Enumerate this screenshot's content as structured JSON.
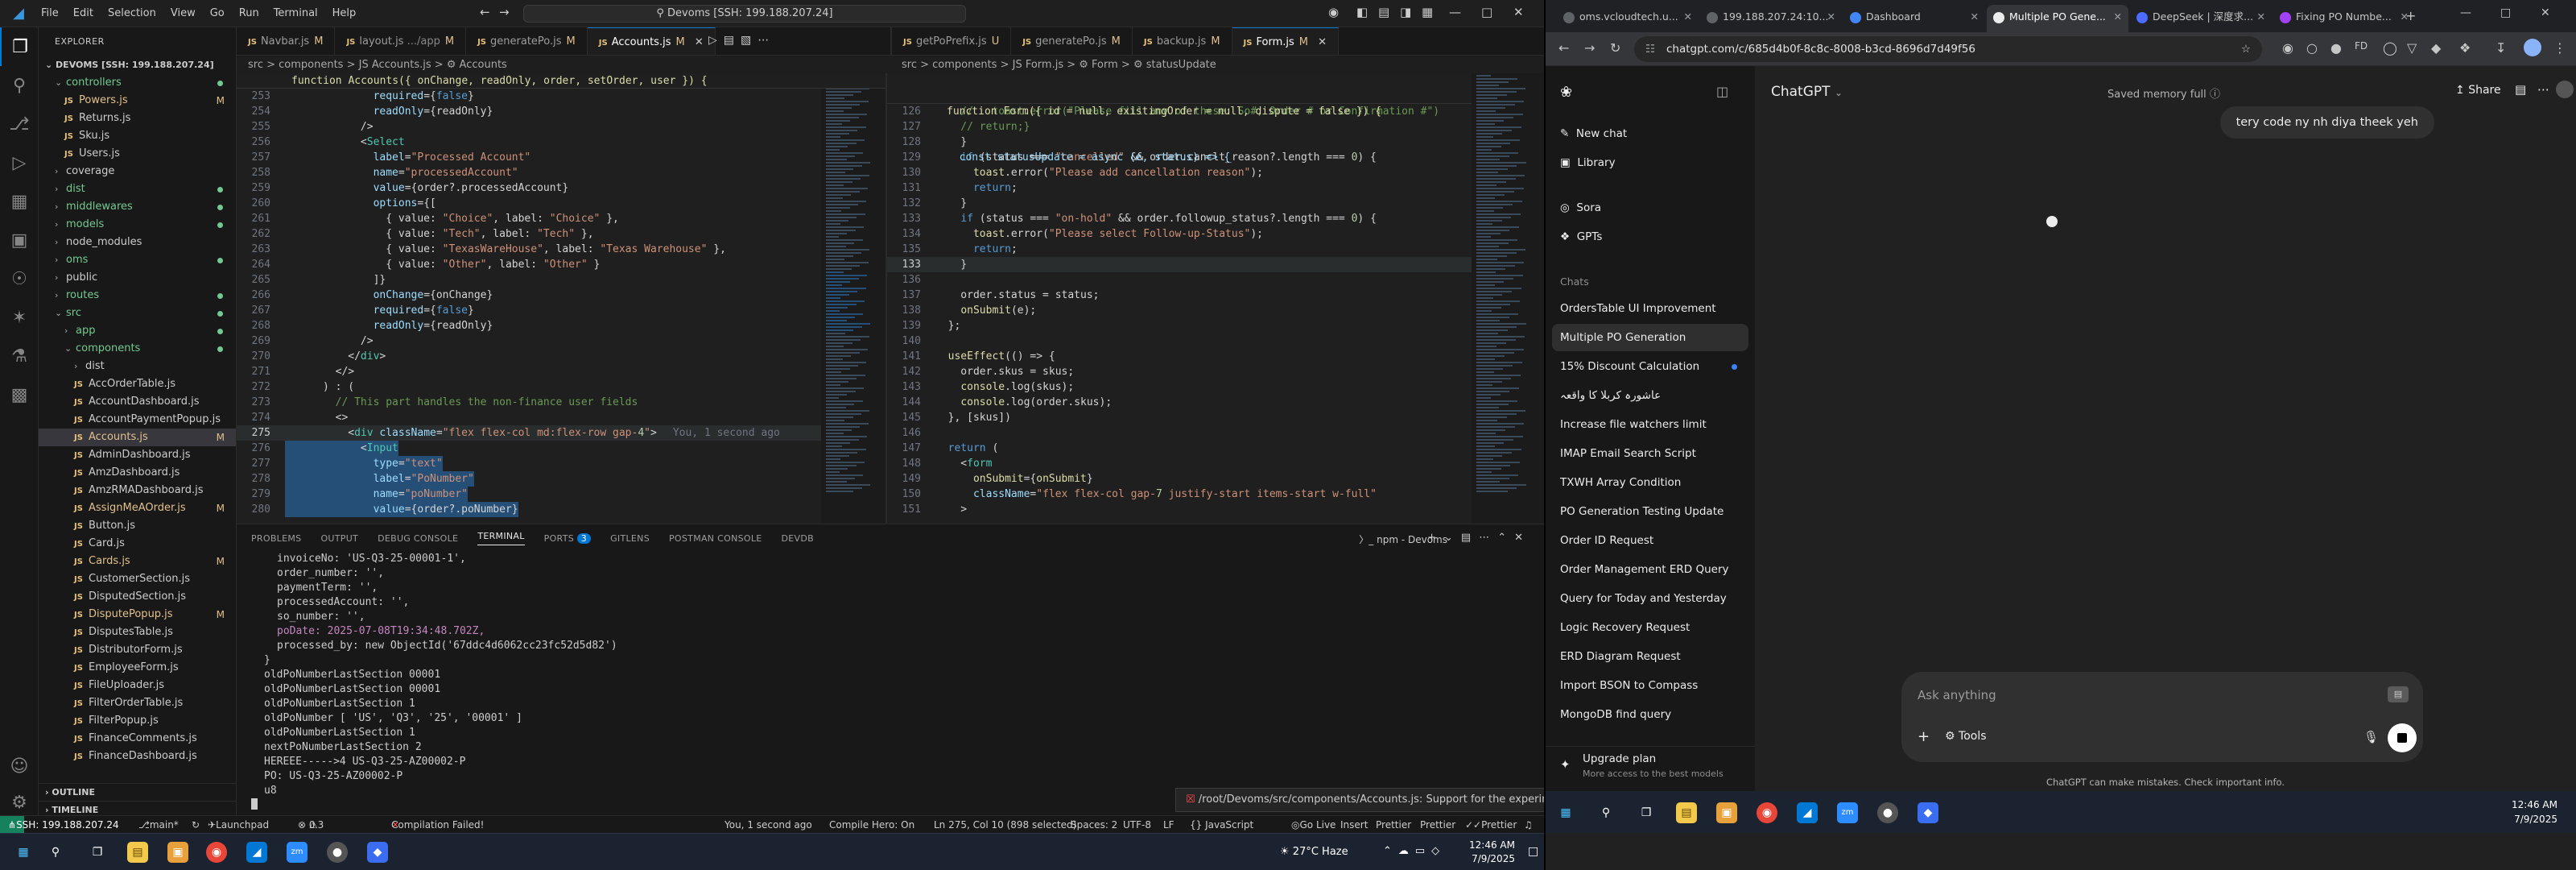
{
  "vscode": {
    "menu": [
      "File",
      "Edit",
      "Selection",
      "View",
      "Go",
      "Run",
      "Terminal",
      "Help"
    ],
    "search": "Devoms [SSH: 199.188.207.24]",
    "explorer_title": "EXPLORER",
    "root": "DEVOMS [SSH: 199.188.207.24]",
    "tree": [
      {
        "label": "controllers",
        "type": "folder",
        "indent": 1,
        "open": true,
        "dot": true
      },
      {
        "label": "Powers.js",
        "type": "file",
        "indent": 2,
        "badge": "M"
      },
      {
        "label": "Returns.js",
        "type": "file",
        "indent": 2
      },
      {
        "label": "Sku.js",
        "type": "file",
        "indent": 2
      },
      {
        "label": "Users.js",
        "type": "file",
        "indent": 2
      },
      {
        "label": "coverage",
        "type": "folder",
        "indent": 1
      },
      {
        "label": "dist",
        "type": "folder",
        "indent": 1,
        "dot": true
      },
      {
        "label": "middlewares",
        "type": "folder",
        "indent": 1,
        "dot": true
      },
      {
        "label": "models",
        "type": "folder",
        "indent": 1,
        "dot": true
      },
      {
        "label": "node_modules",
        "type": "folder",
        "indent": 1
      },
      {
        "label": "oms",
        "type": "folder",
        "indent": 1,
        "dot": true
      },
      {
        "label": "public",
        "type": "folder",
        "indent": 1
      },
      {
        "label": "routes",
        "type": "folder",
        "indent": 1,
        "dot": true
      },
      {
        "label": "src",
        "type": "folder",
        "indent": 1,
        "open": true,
        "dot": true
      },
      {
        "label": "app",
        "type": "folder",
        "indent": 2,
        "dot": true
      },
      {
        "label": "components",
        "type": "folder",
        "indent": 2,
        "open": true,
        "dot": true
      },
      {
        "label": "dist",
        "type": "folder",
        "indent": 3
      },
      {
        "label": "AccOrderTable.js",
        "type": "file",
        "indent": 3
      },
      {
        "label": "AccountDashboard.js",
        "type": "file",
        "indent": 3
      },
      {
        "label": "AccountPaymentPopup.js",
        "type": "file",
        "indent": 3
      },
      {
        "label": "Accounts.js",
        "type": "file",
        "indent": 3,
        "badge": "M",
        "selected": true
      },
      {
        "label": "AdminDashboard.js",
        "type": "file",
        "indent": 3
      },
      {
        "label": "AmzDashboard.js",
        "type": "file",
        "indent": 3
      },
      {
        "label": "AmzRMADashboard.js",
        "type": "file",
        "indent": 3
      },
      {
        "label": "AssignMeAOrder.js",
        "type": "file",
        "indent": 3,
        "badge": "M"
      },
      {
        "label": "Button.js",
        "type": "file",
        "indent": 3
      },
      {
        "label": "Card.js",
        "type": "file",
        "indent": 3
      },
      {
        "label": "Cards.js",
        "type": "file",
        "indent": 3,
        "badge": "M"
      },
      {
        "label": "CustomerSection.js",
        "type": "file",
        "indent": 3
      },
      {
        "label": "DisputedSection.js",
        "type": "file",
        "indent": 3
      },
      {
        "label": "DisputePopup.js",
        "type": "file",
        "indent": 3,
        "badge": "M"
      },
      {
        "label": "DisputesTable.js",
        "type": "file",
        "indent": 3
      },
      {
        "label": "DistributorForm.js",
        "type": "file",
        "indent": 3
      },
      {
        "label": "EmployeeForm.js",
        "type": "file",
        "indent": 3
      },
      {
        "label": "FileUploader.js",
        "type": "file",
        "indent": 3
      },
      {
        "label": "FilterOrderTable.js",
        "type": "file",
        "indent": 3
      },
      {
        "label": "FilterPopup.js",
        "type": "file",
        "indent": 3
      },
      {
        "label": "FinanceComments.js",
        "type": "file",
        "indent": 3
      },
      {
        "label": "FinanceDashboard.js",
        "type": "file",
        "indent": 3
      }
    ],
    "outline": "OUTLINE",
    "timeline": "TIMELINE",
    "tabs_left": [
      {
        "label": "Navbar.js",
        "mark": "M"
      },
      {
        "label": "layout.js",
        "extra": ".../app",
        "mark": "M"
      },
      {
        "label": "generatePo.js",
        "mark": "M"
      },
      {
        "label": "Accounts.js",
        "mark": "M",
        "active": true
      }
    ],
    "tabs_right": [
      {
        "label": "getPoPrefix.js",
        "mark": "U"
      },
      {
        "label": "generatePo.js",
        "mark": "M"
      },
      {
        "label": "backup.js",
        "mark": "M"
      },
      {
        "label": "Form.js",
        "mark": "M",
        "active": true
      }
    ],
    "crumb_left": "src > components > JS Accounts.js > ⚙ Accounts",
    "crumb_right": "src > components > JS Form.js > ⚙ Form > ⚙ statusUpdate",
    "sticky_left": "function Accounts({ onChange, readOnly, order, setOrder, user }) {",
    "sticky_right": "function Form({ id = null, existingOrder = null, dispute = false }) {",
    "sticky_right2": "  const statusUpdate = async (e, status) => {",
    "left_lines": [
      {
        "n": "253",
        "t": "              required={false}"
      },
      {
        "n": "254",
        "t": "              readOnly={readOnly}"
      },
      {
        "n": "255",
        "t": "            />"
      },
      {
        "n": "256",
        "t": "            <Select"
      },
      {
        "n": "257",
        "t": "              label=\"Processed Account\""
      },
      {
        "n": "258",
        "t": "              name=\"processedAccount\""
      },
      {
        "n": "259",
        "t": "              value={order?.processedAccount}"
      },
      {
        "n": "260",
        "t": "              options={["
      },
      {
        "n": "261",
        "t": "                { value: \"Choice\", label: \"Choice\" },"
      },
      {
        "n": "262",
        "t": "                { value: \"Tech\", label: \"Tech\" },"
      },
      {
        "n": "263",
        "t": "                { value: \"TexasWareHouse\", label: \"Texas Warehouse\" },"
      },
      {
        "n": "264",
        "t": "                { value: \"Other\", label: \"Other\" }"
      },
      {
        "n": "265",
        "t": "              ]}"
      },
      {
        "n": "266",
        "t": "              onChange={onChange}"
      },
      {
        "n": "267",
        "t": "              required={false}"
      },
      {
        "n": "268",
        "t": "              readOnly={readOnly}"
      },
      {
        "n": "269",
        "t": "            />"
      },
      {
        "n": "270",
        "t": "          </div>"
      },
      {
        "n": "271",
        "t": "        </>"
      },
      {
        "n": "272",
        "t": "      ) : ("
      },
      {
        "n": "273",
        "t": "        // This part handles the non-finance user fields"
      },
      {
        "n": "274",
        "t": "        <>"
      },
      {
        "n": "275",
        "t": "          <div className=\"flex flex-col md:flex-row gap-4\">",
        "cur": true
      },
      {
        "n": "276",
        "t": "            <Input",
        "sel": true
      },
      {
        "n": "277",
        "t": "              type=\"text\"",
        "sel": true
      },
      {
        "n": "278",
        "t": "              label=\"PoNumber\"",
        "sel": true
      },
      {
        "n": "279",
        "t": "              name=\"poNumber\"",
        "sel": true
      },
      {
        "n": "280",
        "t": "              value={order?.poNumber}",
        "sel": true
      }
    ],
    "blame": "You, 1 second ago",
    "right_lines": [
      {
        "n": "126",
        "t": "    //   toast.error(\"Please fill any of these: So#, Order # or Confirmation #\")"
      },
      {
        "n": "127",
        "t": "    // return;}"
      },
      {
        "n": "128",
        "t": "    }"
      },
      {
        "n": "129",
        "t": "    if (status === \"cancelled\" && order.canclt_reason?.length === 0) {"
      },
      {
        "n": "130",
        "t": "      toast.error(\"Please add cancellation reason\");"
      },
      {
        "n": "131",
        "t": "      return;"
      },
      {
        "n": "132",
        "t": "    }"
      },
      {
        "n": "133",
        "t": "    if (status === \"on-hold\" && order.followup_status?.length === 0) {"
      },
      {
        "n": "134",
        "t": "      toast.error(\"Please select Follow-up-Status\");"
      },
      {
        "n": "135",
        "t": "      return;"
      },
      {
        "n": "133",
        "t": "    }",
        "cur": true
      },
      {
        "n": "136",
        "t": ""
      },
      {
        "n": "137",
        "t": "    order.status = status;"
      },
      {
        "n": "138",
        "t": "    onSubmit(e);"
      },
      {
        "n": "139",
        "t": "  };"
      },
      {
        "n": "140",
        "t": ""
      },
      {
        "n": "141",
        "t": "  useEffect(() => {"
      },
      {
        "n": "142",
        "t": "    order.skus = skus;"
      },
      {
        "n": "143",
        "t": "    console.log(skus);"
      },
      {
        "n": "144",
        "t": "    console.log(order.skus);"
      },
      {
        "n": "145",
        "t": "  }, [skus])"
      },
      {
        "n": "146",
        "t": ""
      },
      {
        "n": "147",
        "t": "  return ("
      },
      {
        "n": "148",
        "t": "    <form"
      },
      {
        "n": "149",
        "t": "      onSubmit={onSubmit}"
      },
      {
        "n": "150",
        "t": "      className=\"flex flex-col gap-7 justify-start items-start w-full\""
      },
      {
        "n": "151",
        "t": "    >"
      }
    ],
    "panel_tabs": [
      "PROBLEMS",
      "OUTPUT",
      "DEBUG CONSOLE",
      "TERMINAL",
      "PORTS",
      "GITLENS",
      "POSTMAN CONSOLE",
      "DEVDB"
    ],
    "ports_count": "3",
    "term_label": "npm - Devoms",
    "terminal": [
      "invoiceNo: 'US-Q3-25-00001-1',",
      "order_number: '',",
      "paymentTerm: '',",
      "processedAccount: '',",
      "so_number: '',",
      "poDate: 2025-07-08T19:34:48.702Z,",
      "processed_by: new ObjectId('67ddc4d6062cc23fc52d5d82')",
      "}",
      "oldPoNumberLastSection 00001",
      "oldPoNumberLastSection 00001",
      "oldPoNumberLastSection 1",
      "oldPoNumber [ 'US', 'Q3', '25', '00001' ]",
      "oldPoNumberLastSection 1",
      "nextPoNumberLastSection 2",
      "HEREEE----->4 US-Q3-25-AZ00002-P",
      "PO: US-Q3-25-AZ00002-P",
      "u8"
    ],
    "toast": "/root/Devoms/src/components/Accounts.js: Support for the experime...",
    "status": {
      "remote": "SSH: 199.188.207.24",
      "branch": "main*",
      "errors": "0",
      "warnings": "3",
      "compile": "Compilation Failed!",
      "blame": "You, 1 second ago",
      "compile_hero": "Compile Hero: On",
      "position": "Ln 275, Col 10 (898 selected)",
      "spaces": "Spaces: 2",
      "encoding": "UTF-8",
      "eol": "LF",
      "lang": "{} JavaScript",
      "golive": "Go Live",
      "insert": "Insert",
      "prettier1": "Prettier",
      "prettier2": "Prettier",
      "prettier3": "Prettier",
      "launchpad": "Launchpad"
    },
    "weather": "27°C Haze",
    "time_left": "12:46 AM",
    "date_left": "7/9/2025"
  },
  "chrome": {
    "tabs": [
      {
        "label": "oms.vcloudtech.u...",
        "color": "#5f6368"
      },
      {
        "label": "199.188.207.24:10...",
        "color": "#5f6368"
      },
      {
        "label": "Dashboard",
        "color": "#4285f4"
      },
      {
        "label": "Multiple PO Gene...",
        "color": "#ececec",
        "active": true
      },
      {
        "label": "DeepSeek | 深度求...",
        "color": "#4d6bfe"
      },
      {
        "label": "Fixing PO Numbe...",
        "color": "#a142f4"
      }
    ],
    "url": "chatgpt.com/c/685d4b0f-8c8c-8008-b3cd-8696d7d49f56"
  },
  "chatgpt": {
    "new_chat": "New chat",
    "library": "Library",
    "sora": "Sora",
    "gpts": "GPTs",
    "chats_label": "Chats",
    "chats": [
      "OrdersTable UI Improvement",
      "Multiple PO Generation",
      "15% Discount Calculation",
      "عاشورہ کربلا کا واقعہ",
      "Increase file watchers limit",
      "IMAP Email Search Script",
      "TXWH Array Condition",
      "PO Generation Testing Update",
      "Order ID Request",
      "Order Management ERD Query",
      "Query for Today and Yesterday",
      "Logic Recovery Request",
      "ERD Diagram Request",
      "Import BSON to Compass",
      "MongoDB find query"
    ],
    "upgrade": "Upgrade plan",
    "upgrade_sub": "More access to the best models",
    "model": "ChatGPT",
    "memory": "Saved memory full",
    "share": "Share",
    "message": "tery code ny nh diya theek yeh",
    "placeholder": "Ask anything",
    "tools": "Tools",
    "disclaimer": "ChatGPT can make mistakes. Check important info.",
    "time": "12:46 AM",
    "date": "7/9/2025"
  }
}
